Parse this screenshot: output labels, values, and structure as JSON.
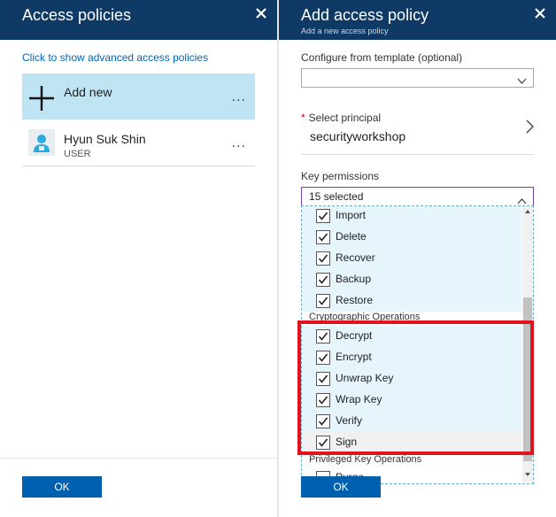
{
  "left_blade": {
    "title": "Access policies",
    "advanced_link": "Click to show advanced access policies",
    "add_new_label": "Add new",
    "more_glyph": "...",
    "users": [
      {
        "name": "Hyun Suk Shin",
        "type": "USER"
      }
    ],
    "ok_label": "OK"
  },
  "right_blade": {
    "title": "Add access policy",
    "subtitle": "Add a new access policy",
    "template_label": "Configure from template (optional)",
    "template_value": "",
    "principal_label": "Select principal",
    "principal_required_mark": "*",
    "principal_value": "securityworkshop",
    "key_permissions_label": "Key permissions",
    "key_permissions_value": "15 selected",
    "permission_items": [
      {
        "label": "Import",
        "checked": true
      },
      {
        "label": "Delete",
        "checked": true
      },
      {
        "label": "Recover",
        "checked": true
      },
      {
        "label": "Backup",
        "checked": true
      },
      {
        "label": "Restore",
        "checked": true
      }
    ],
    "group_crypto": "Cryptographic Operations",
    "crypto_items": [
      {
        "label": "Decrypt",
        "checked": true
      },
      {
        "label": "Encrypt",
        "checked": true
      },
      {
        "label": "Unwrap Key",
        "checked": true
      },
      {
        "label": "Wrap Key",
        "checked": true
      },
      {
        "label": "Verify",
        "checked": true
      },
      {
        "label": "Sign",
        "checked": true
      }
    ],
    "group_privileged": "Privileged Key Operations",
    "privileged_items": [
      {
        "label": "Purge",
        "checked": false
      }
    ],
    "ok_label": "OK"
  },
  "colors": {
    "header_bg": "#0f3a66",
    "selected_item_bg": "#bfe5f5",
    "link": "#0066b8",
    "ok_button": "#0060b0",
    "highlight_box": "#e0141e",
    "focus_border": "#7b3fa0"
  },
  "icons": {
    "close": "close-icon",
    "add": "plus-icon",
    "user": "user-avatar-icon",
    "chevron_right": "chevron-right-icon",
    "chevron_down": "chevron-down-icon",
    "chevron_up": "chevron-up-icon",
    "checkbox": "checkmark-icon"
  }
}
